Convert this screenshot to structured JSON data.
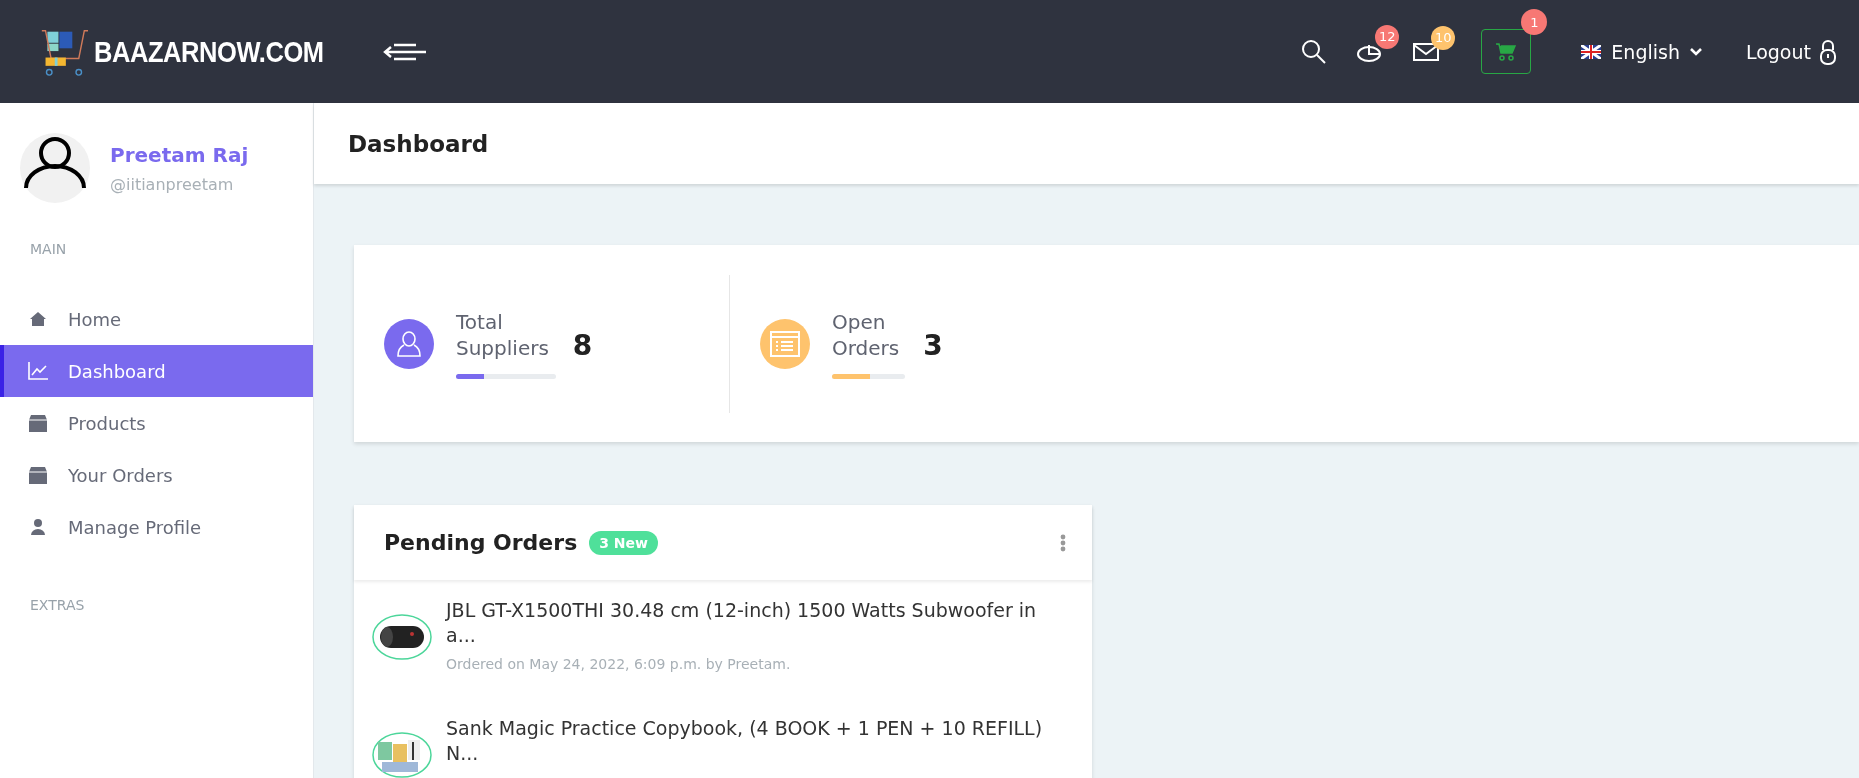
{
  "header": {
    "brand": "BAAZARNOW.COM",
    "badges": [
      {
        "kind": "chart",
        "count": "12",
        "color": "#f77874"
      },
      {
        "kind": "mail",
        "count": "10",
        "color": "#fec36d"
      },
      {
        "kind": "cart",
        "count": "1",
        "color": "#f77874"
      }
    ],
    "language": "English",
    "logout": "Logout"
  },
  "profile": {
    "name": "Preetam Raj",
    "handle": "@iitianpreetam"
  },
  "sidebar": {
    "sections": [
      {
        "title": "MAIN",
        "items": [
          {
            "label": "Home",
            "kind": "home",
            "selected": false
          },
          {
            "label": "Dashboard",
            "kind": "chart",
            "selected": true
          },
          {
            "label": "Products",
            "kind": "box",
            "selected": false
          },
          {
            "label": "Your Orders",
            "kind": "box",
            "selected": false
          },
          {
            "label": "Manage Profile",
            "kind": "user",
            "selected": false
          }
        ]
      },
      {
        "title": "EXTRAS"
      }
    ]
  },
  "page": {
    "title": "Dashboard"
  },
  "stats": [
    {
      "kind": "suppliers",
      "label_lines": [
        "Total",
        "Suppliers"
      ],
      "value": "8",
      "color": "#7a6aee",
      "level": 0.28
    },
    {
      "kind": "orders",
      "label_lines": [
        "Open",
        "Orders"
      ],
      "value": "3",
      "color": "#fec36d",
      "level": 0.52
    }
  ],
  "pending_orders": {
    "title": "Pending Orders",
    "badge": "3 New",
    "items": [
      {
        "title": "JBL GT-X1500THI 30.48 cm (12-inch) 1500 Watts Subwoofer in a...",
        "meta": "Ordered on May 24, 2022, 6:09 p.m. by Preetam.",
        "kind": "speaker"
      },
      {
        "title": "Sank Magic Practice Copybook, (4 BOOK + 1 PEN + 10 REFILL) N...",
        "kind": "books"
      }
    ]
  }
}
